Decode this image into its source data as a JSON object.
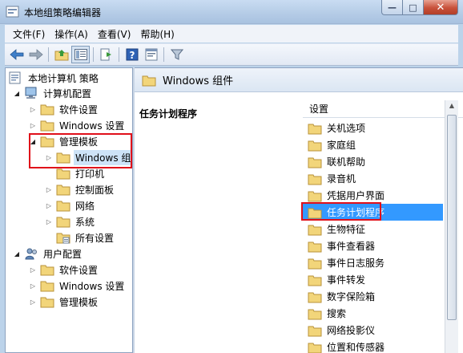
{
  "window": {
    "title": "本地组策略编辑器",
    "buttons": {
      "minimize": "—",
      "maximize": "□",
      "close": "✕"
    }
  },
  "menu": [
    "文件(F)",
    "操作(A)",
    "查看(V)",
    "帮助(H)"
  ],
  "toolbar": [
    "back-icon",
    "forward-icon",
    "up-folder-icon",
    "show-tree-icon",
    "export-icon",
    "help-icon",
    "properties-icon",
    "filter-icon"
  ],
  "tree": {
    "root": "本地计算机 策略",
    "computer_config": "计算机配置",
    "software_settings": "软件设置",
    "windows_settings": "Windows 设置",
    "admin_templates": "管理模板",
    "windows_components": "Windows 组件",
    "printers": "打印机",
    "control_panel": "控制面板",
    "network": "网络",
    "system": "系统",
    "all_settings": "所有设置",
    "user_config": "用户配置",
    "user_software_settings": "软件设置",
    "user_windows_settings": "Windows 设置",
    "user_admin_templates": "管理模板"
  },
  "right": {
    "header": "Windows 组件",
    "description_title": "任务计划程序",
    "column_header": "设置",
    "items": [
      "关机选项",
      "家庭组",
      "联机帮助",
      "录音机",
      "凭据用户界面",
      "任务计划程序",
      "生物特征",
      "事件查看器",
      "事件日志服务",
      "事件转发",
      "数字保险箱",
      "搜索",
      "网络投影仪",
      "位置和传感器"
    ],
    "selected_index": 5
  },
  "colors": {
    "highlight_border": "#e0101a",
    "selection": "#3399ff",
    "folder": "#f2d57a"
  }
}
